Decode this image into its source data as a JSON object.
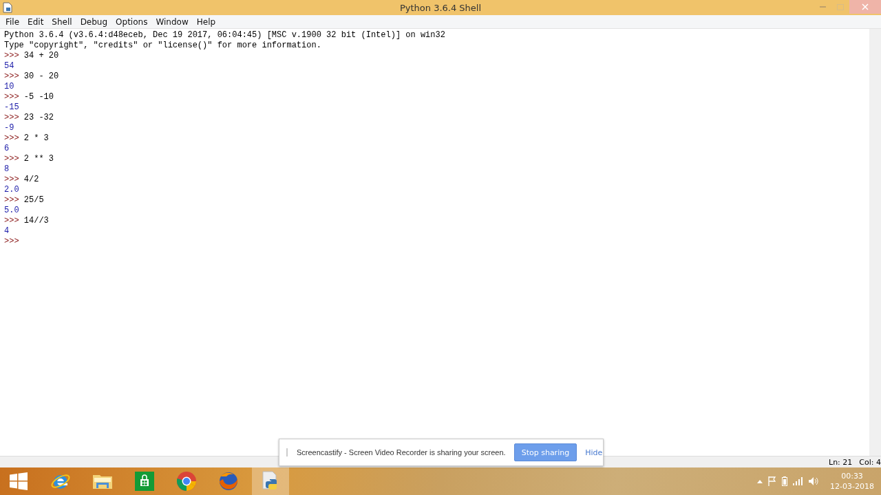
{
  "window": {
    "title": "Python 3.6.4 Shell"
  },
  "menu": [
    "File",
    "Edit",
    "Shell",
    "Debug",
    "Options",
    "Window",
    "Help"
  ],
  "lines": [
    {
      "kind": "header",
      "text": "Python 3.6.4 (v3.6.4:d48eceb, Dec 19 2017, 06:04:45) [MSC v.1900 32 bit (Intel)] on win32"
    },
    {
      "kind": "header",
      "text": "Type \"copyright\", \"credits\" or \"license()\" for more information."
    },
    {
      "kind": "input",
      "prompt": ">>>",
      "text": "34 + 20"
    },
    {
      "kind": "output",
      "text": "54"
    },
    {
      "kind": "input",
      "prompt": ">>>",
      "text": "30 - 20"
    },
    {
      "kind": "output",
      "text": "10"
    },
    {
      "kind": "input",
      "prompt": ">>>",
      "text": "-5 -10"
    },
    {
      "kind": "output",
      "text": "-15"
    },
    {
      "kind": "input",
      "prompt": ">>>",
      "text": "23 -32"
    },
    {
      "kind": "output",
      "text": "-9"
    },
    {
      "kind": "input",
      "prompt": ">>>",
      "text": "2 * 3"
    },
    {
      "kind": "output",
      "text": "6"
    },
    {
      "kind": "input",
      "prompt": ">>>",
      "text": "2 ** 3"
    },
    {
      "kind": "output",
      "text": "8"
    },
    {
      "kind": "input",
      "prompt": ">>>",
      "text": "4/2"
    },
    {
      "kind": "output",
      "text": "2.0"
    },
    {
      "kind": "input",
      "prompt": ">>>",
      "text": "25/5"
    },
    {
      "kind": "output",
      "text": "5.0"
    },
    {
      "kind": "input",
      "prompt": ">>>",
      "text": "14//3"
    },
    {
      "kind": "output",
      "text": "4"
    },
    {
      "kind": "input",
      "prompt": ">>>"
    }
  ],
  "status_bar": {
    "line": "Ln: 21",
    "column": "Col: 4"
  },
  "notification": {
    "message": "Screencastify - Screen Video Recorder is sharing your screen.",
    "buttons": [
      "Stop sharing",
      "Hide"
    ]
  },
  "taskbar": {
    "apps": [
      {
        "kind": "start",
        "selected": false
      },
      {
        "kind": "ie",
        "selected": false
      },
      {
        "kind": "explorer",
        "selected": false
      },
      {
        "kind": "store",
        "selected": false
      },
      {
        "kind": "chrome",
        "selected": false
      },
      {
        "kind": "firefox",
        "selected": false
      },
      {
        "kind": "python",
        "selected": true
      }
    ],
    "clock": {
      "time": "00:33",
      "date": "12-03-2018"
    }
  }
}
